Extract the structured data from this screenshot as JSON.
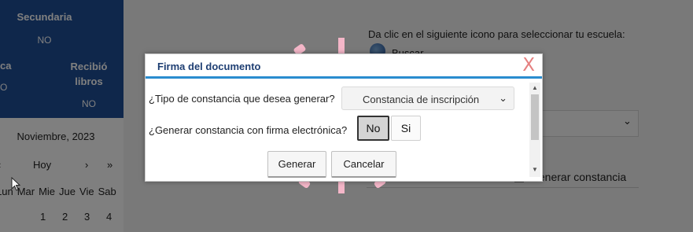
{
  "background": {
    "table": {
      "col_secundaria": "Secundaria",
      "val_secundaria": "NO",
      "col_partial": "ca",
      "val_partial": "O",
      "col_recibio": "Recibió libros",
      "val_recibio": "NO"
    },
    "calendar": {
      "month": "Noviembre, 2023",
      "prev": "‹",
      "today": "Hoy",
      "next": "›",
      "next_year": "»",
      "weekdays": [
        "Lun",
        "Mar",
        "Mie",
        "Jue",
        "Vie",
        "Sab"
      ],
      "days": [
        "1",
        "2",
        "3",
        "4"
      ]
    },
    "school": {
      "instruction": "Da clic en el siguiente icono para seleccionar tu escuela:",
      "search_label": "Buscar",
      "search_icon": "globe-icon"
    },
    "generate_checkbox_label": "Generar constancia"
  },
  "modal": {
    "title": "Firma del documento",
    "close_label": "X",
    "question_type": "¿Tipo de constancia que desea generar?",
    "select_value": "Constancia de inscripción",
    "question_sign": "¿Generar constancia con firma electrónica?",
    "btn_no": "No",
    "btn_si": "Si",
    "btn_generate": "Generar",
    "btn_cancel": "Cancelar"
  },
  "colors": {
    "header_blue": "#1f4e96",
    "modal_accent": "#2a8ccf",
    "close_red": "#e58080"
  }
}
